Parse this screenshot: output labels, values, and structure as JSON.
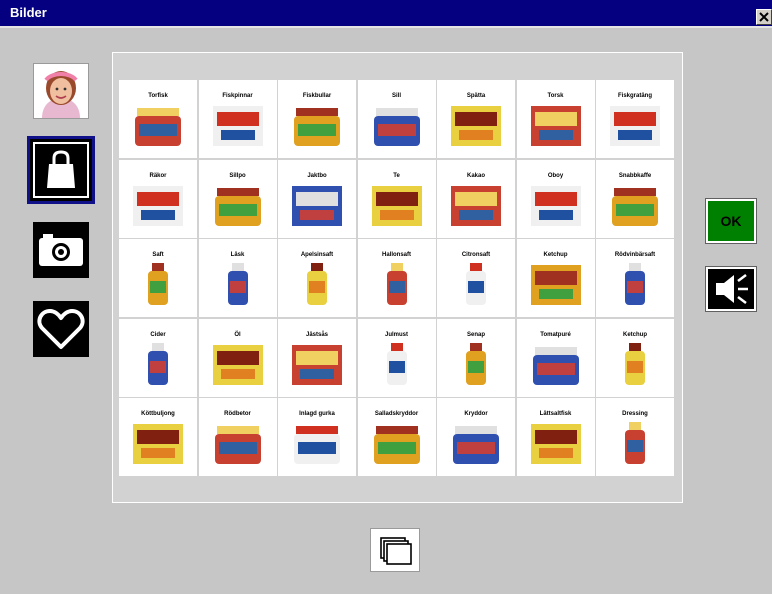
{
  "window": {
    "title": "Bilder"
  },
  "categories": [
    {
      "name": "person",
      "icon": "girl-photo-icon"
    },
    {
      "name": "shopping",
      "icon": "shopping-bag-icon",
      "selected": true
    },
    {
      "name": "photos",
      "icon": "camera-icon"
    },
    {
      "name": "favorites",
      "icon": "heart-icon"
    }
  ],
  "grid": {
    "rows": [
      [
        {
          "label": "Torfisk",
          "icon": "canned-fish-icon"
        },
        {
          "label": "Fiskpinnar",
          "icon": "fish-sticks-box-icon"
        },
        {
          "label": "Fiskbullar",
          "icon": "fish-balls-can-icon"
        },
        {
          "label": "Sill",
          "icon": "herring-jars-icon"
        },
        {
          "label": "Spätta",
          "icon": "fish-fillet-package-icon"
        },
        {
          "label": "Torsk",
          "icon": "cod-package-icon"
        },
        {
          "label": "Fiskgratäng",
          "icon": "fish-gratin-box-icon"
        }
      ],
      [
        {
          "label": "Räkor",
          "icon": "shrimp-bag-icon"
        },
        {
          "label": "Sillpo",
          "icon": "tins-icon"
        },
        {
          "label": "Jaktbo",
          "icon": "snack-bag-icon"
        },
        {
          "label": "Te",
          "icon": "tea-box-icon"
        },
        {
          "label": "Kakao",
          "icon": "cocoa-package-icon"
        },
        {
          "label": "Oboy",
          "icon": "oboy-package-icon"
        },
        {
          "label": "Snabbkaffe",
          "icon": "instant-coffee-jars-icon"
        }
      ],
      [
        {
          "label": "Saft",
          "icon": "juice-bottles-icon"
        },
        {
          "label": "Läsk",
          "icon": "soda-bottle-icon"
        },
        {
          "label": "Apelsinsaft",
          "icon": "orange-juice-bottle-icon"
        },
        {
          "label": "Hallonsaft",
          "icon": "raspberry-juice-bottle-icon"
        },
        {
          "label": "Citronsaft",
          "icon": "lemon-juice-bottle-icon"
        },
        {
          "label": "Ketchup",
          "icon": "ketchup-box-icon"
        },
        {
          "label": "Rödvinbärsaft",
          "icon": "currant-juice-bottle-icon"
        }
      ],
      [
        {
          "label": "Cider",
          "icon": "cider-bottle-icon"
        },
        {
          "label": "Öl",
          "icon": "beer-pack-icon"
        },
        {
          "label": "Jästsås",
          "icon": "sauce-box-icon"
        },
        {
          "label": "Julmust",
          "icon": "julmust-bottle-icon"
        },
        {
          "label": "Senap",
          "icon": "mustard-bottle-icon"
        },
        {
          "label": "Tomatpuré",
          "icon": "tomato-jar-icon"
        },
        {
          "label": "Ketchup",
          "icon": "ketchup-bottle-icon"
        }
      ],
      [
        {
          "label": "Köttbuljong",
          "icon": "stock-cubes-icon"
        },
        {
          "label": "Rödbetor",
          "icon": "beetroot-jar-icon"
        },
        {
          "label": "Inlagd gurka",
          "icon": "pickles-jar-icon"
        },
        {
          "label": "Salladskryddor",
          "icon": "spice-jars-icon"
        },
        {
          "label": "Kryddor",
          "icon": "spice-jars-dark-icon"
        },
        {
          "label": "Lättsaltfisk",
          "icon": "fish-packages-icon"
        },
        {
          "label": "Dressing",
          "icon": "dressing-bottle-icon"
        }
      ]
    ]
  },
  "buttons": {
    "ok_label": "OK",
    "speaker": "speaker-icon",
    "pages": "pages-icon",
    "close": "close-icon"
  },
  "colors": {
    "titlebar": "#040080",
    "ok": "#008000",
    "background": "#c6c6c6",
    "selected_border": "#101088"
  }
}
